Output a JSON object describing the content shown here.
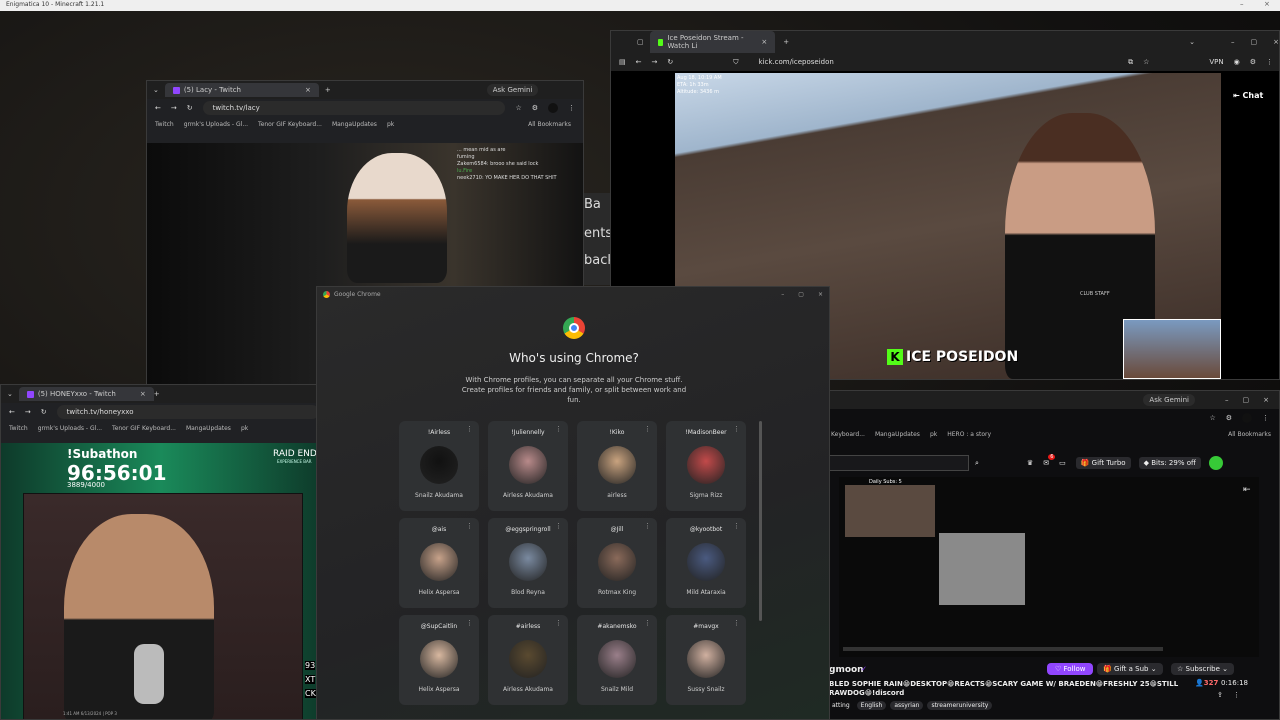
{
  "desktop": {
    "titlebar_text": "Enigmatica 10 - Minecraft 1.21.1"
  },
  "lacy_window": {
    "tab_label": "(5) Lacy - Twitch",
    "url": "twitch.tv/lacy",
    "ask_gemini": "Ask Gemini",
    "bookmarks": [
      "Twitch",
      "grmk's Uploads - Gl...",
      "Tenor GIF Keyboard...",
      "MangaUpdates",
      "pk"
    ],
    "all_bookmarks": "All Bookmarks",
    "chat_lines": [
      "... mean mid as are",
      "fuming",
      "Zakem6584: brooo she said lock",
      "lu.Fire",
      "neek2710: YO MAKE HER DO THAT SHIT"
    ],
    "side_text": [
      "Ba",
      "ents",
      "back"
    ]
  },
  "kick_window": {
    "tab_label": "Ice Poseidon Stream - Watch Li",
    "url": "kick.com/iceposeidon",
    "vpn": "VPN",
    "chat_button": "Chat",
    "overlay": [
      "Aug 18, 10:19 AM",
      "ETA: 1h 33m",
      "Altitude: 3436 m"
    ],
    "streamer_logo": "ICE POSEIDON",
    "shirt_text": "CLUB STAFF"
  },
  "honey_window": {
    "tab_label": "(5) HONEYxxo - Twitch",
    "url": "twitch.tv/honeyxxo",
    "bookmarks": [
      "Twitch",
      "grmk's Uploads - Gl...",
      "Tenor GIF Keyboard...",
      "MangaUpdates",
      "pk"
    ],
    "subathon_title": "!Subathon",
    "timer": "96:56:01",
    "count": "3889/4000",
    "raid": "RAID END",
    "raid_sub": "EXPERIENCE BAR",
    "side_nums": [
      "93",
      "XT",
      "CK"
    ],
    "footer": "1:41 AM 6/13/2024 | POP 3"
  },
  "chrome_profiles": {
    "window_title": "Google Chrome",
    "heading": "Who's using Chrome?",
    "subtext": "With Chrome profiles, you can separate all your Chrome stuff. Create profiles for friends and family, or split between work and fun.",
    "profiles": [
      {
        "handle": "!Airless",
        "name": "Snailz Akudama",
        "color": "#111111"
      },
      {
        "handle": "!Juliennelly",
        "name": "Airless Akudama",
        "color": "#b88a8a"
      },
      {
        "handle": "!Kiko",
        "name": "airless",
        "color": "#c9a37f"
      },
      {
        "handle": "!MadisonBeer",
        "name": "Sigma Rizz",
        "color": "#c24a4a"
      },
      {
        "handle": "@ais",
        "name": "Helix Aspersa",
        "color": "#c7a28a"
      },
      {
        "handle": "@eggspringroll",
        "name": "Blod Reyna",
        "color": "#7a8aa0"
      },
      {
        "handle": "@Jill",
        "name": "Rotmax King",
        "color": "#8a6a5a"
      },
      {
        "handle": "@kyootbot",
        "name": "Mild Ataraxia",
        "color": "#4a5a80"
      },
      {
        "handle": "@SupCaitlin",
        "name": "Helix Aspersa",
        "color": "#d8b8a0"
      },
      {
        "handle": "#airless",
        "name": "Airless Akudama",
        "color": "#5a4a30"
      },
      {
        "handle": "#akanemsko",
        "name": "Snailz Mild",
        "color": "#9a7f8a"
      },
      {
        "handle": "#mavgx",
        "name": "Sussy Snailz",
        "color": "#d0b0a0"
      }
    ]
  },
  "twitch_window": {
    "ask_gemini": "Ask Gemini",
    "bookmarks": [
      "Keyboard...",
      "MangaUpdates",
      "pk",
      "HERO : a story"
    ],
    "all_bookmarks": "All Bookmarks",
    "notif_count": "6",
    "gift_turbo": "Gift Turbo",
    "bits": "Bits: 29% off",
    "daily_subs": "Daily Subs: 5",
    "channel_name": "gmoon",
    "follow": "Follow",
    "gift_sub": "Gift a Sub",
    "subscribe": "Subscribe",
    "title_line1": "BLED SOPHIE RAIN😁DESKTOP😁REACTS😁SCARY GAME W/ BRAEDEN😁FRESHLY 25😁STILL",
    "title_line2": "RAWDOG😁!discord",
    "viewers": "327",
    "uptime": "0:16:18",
    "tags": [
      "atting",
      "English",
      "assyrian",
      "streameruniversity"
    ]
  }
}
